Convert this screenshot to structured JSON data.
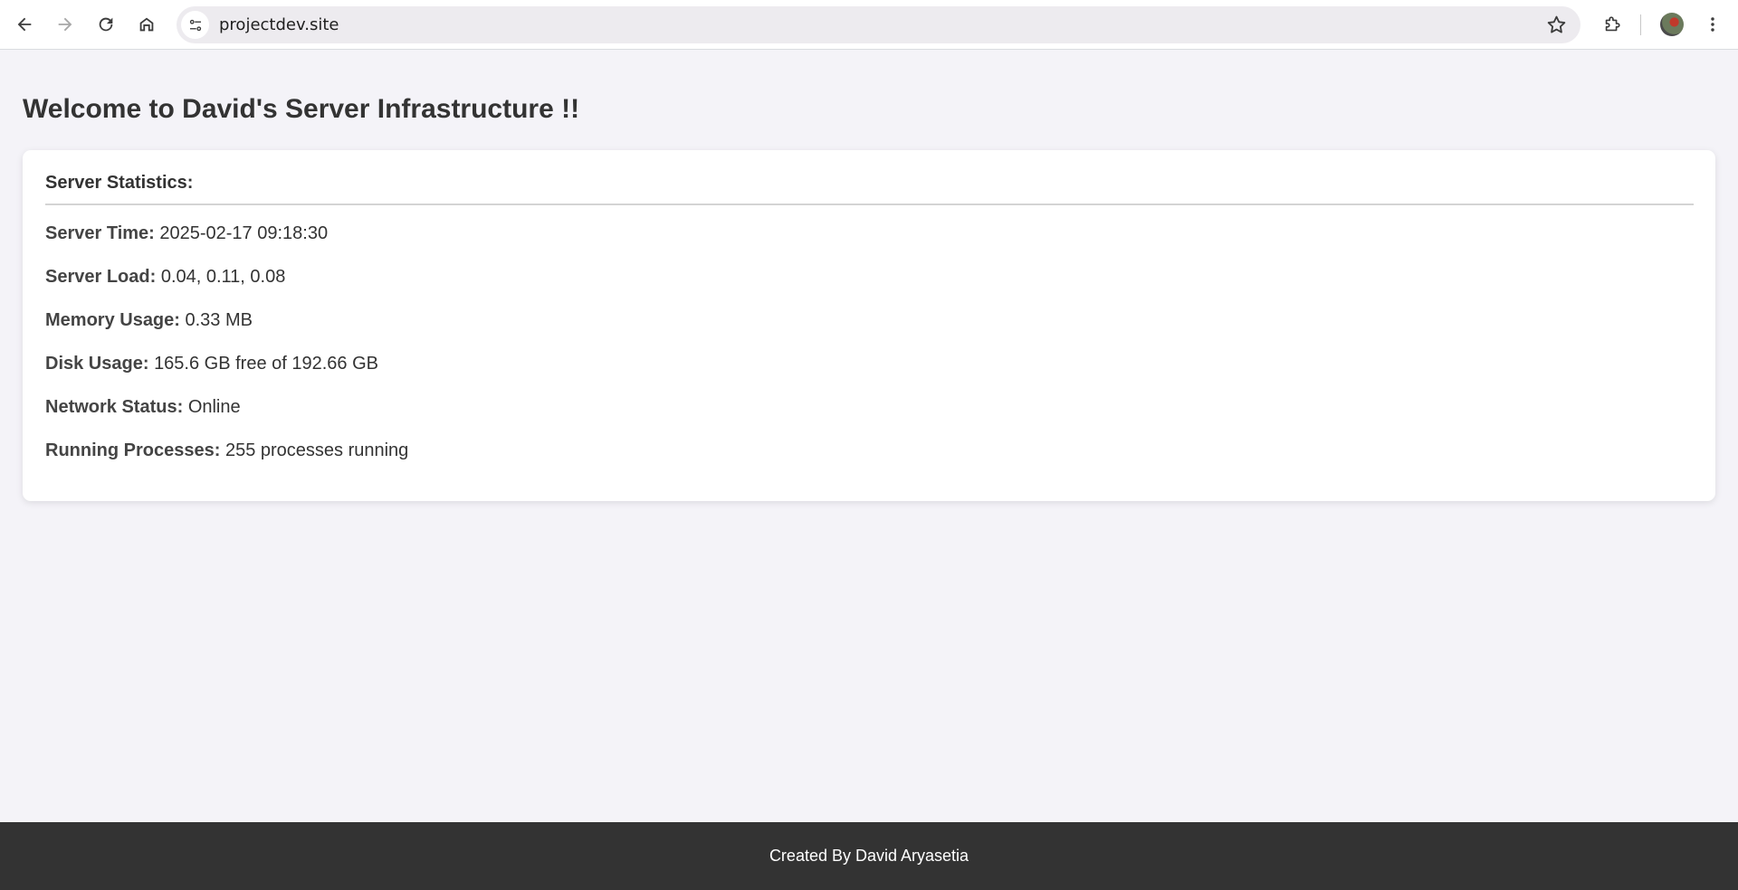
{
  "browser": {
    "url": "projectdev.site"
  },
  "page": {
    "title": "Welcome to David's Server Infrastructure !!"
  },
  "stats": {
    "heading": "Server Statistics:",
    "rows": [
      {
        "label": "Server Time:",
        "value": "2025-02-17 09:18:30"
      },
      {
        "label": "Server Load:",
        "value": "0.04, 0.11, 0.08"
      },
      {
        "label": "Memory Usage:",
        "value": "0.33 MB"
      },
      {
        "label": "Disk Usage:",
        "value": "165.6 GB free of 192.66 GB"
      },
      {
        "label": "Network Status:",
        "value": "Online"
      },
      {
        "label": "Running Processes:",
        "value": "255 processes running"
      }
    ]
  },
  "footer": {
    "text": "Created By David Aryasetia"
  },
  "icons": {
    "back": "back-arrow-icon",
    "forward": "forward-arrow-icon",
    "reload": "reload-icon",
    "home": "home-icon",
    "site_info": "site-info-icon",
    "bookmark": "star-icon",
    "extensions": "puzzle-icon",
    "menu": "kebab-menu-icon"
  },
  "colors": {
    "page_bg": "#f4f3f8",
    "card_bg": "#ffffff",
    "footer_bg": "#333333",
    "text": "#333333"
  }
}
